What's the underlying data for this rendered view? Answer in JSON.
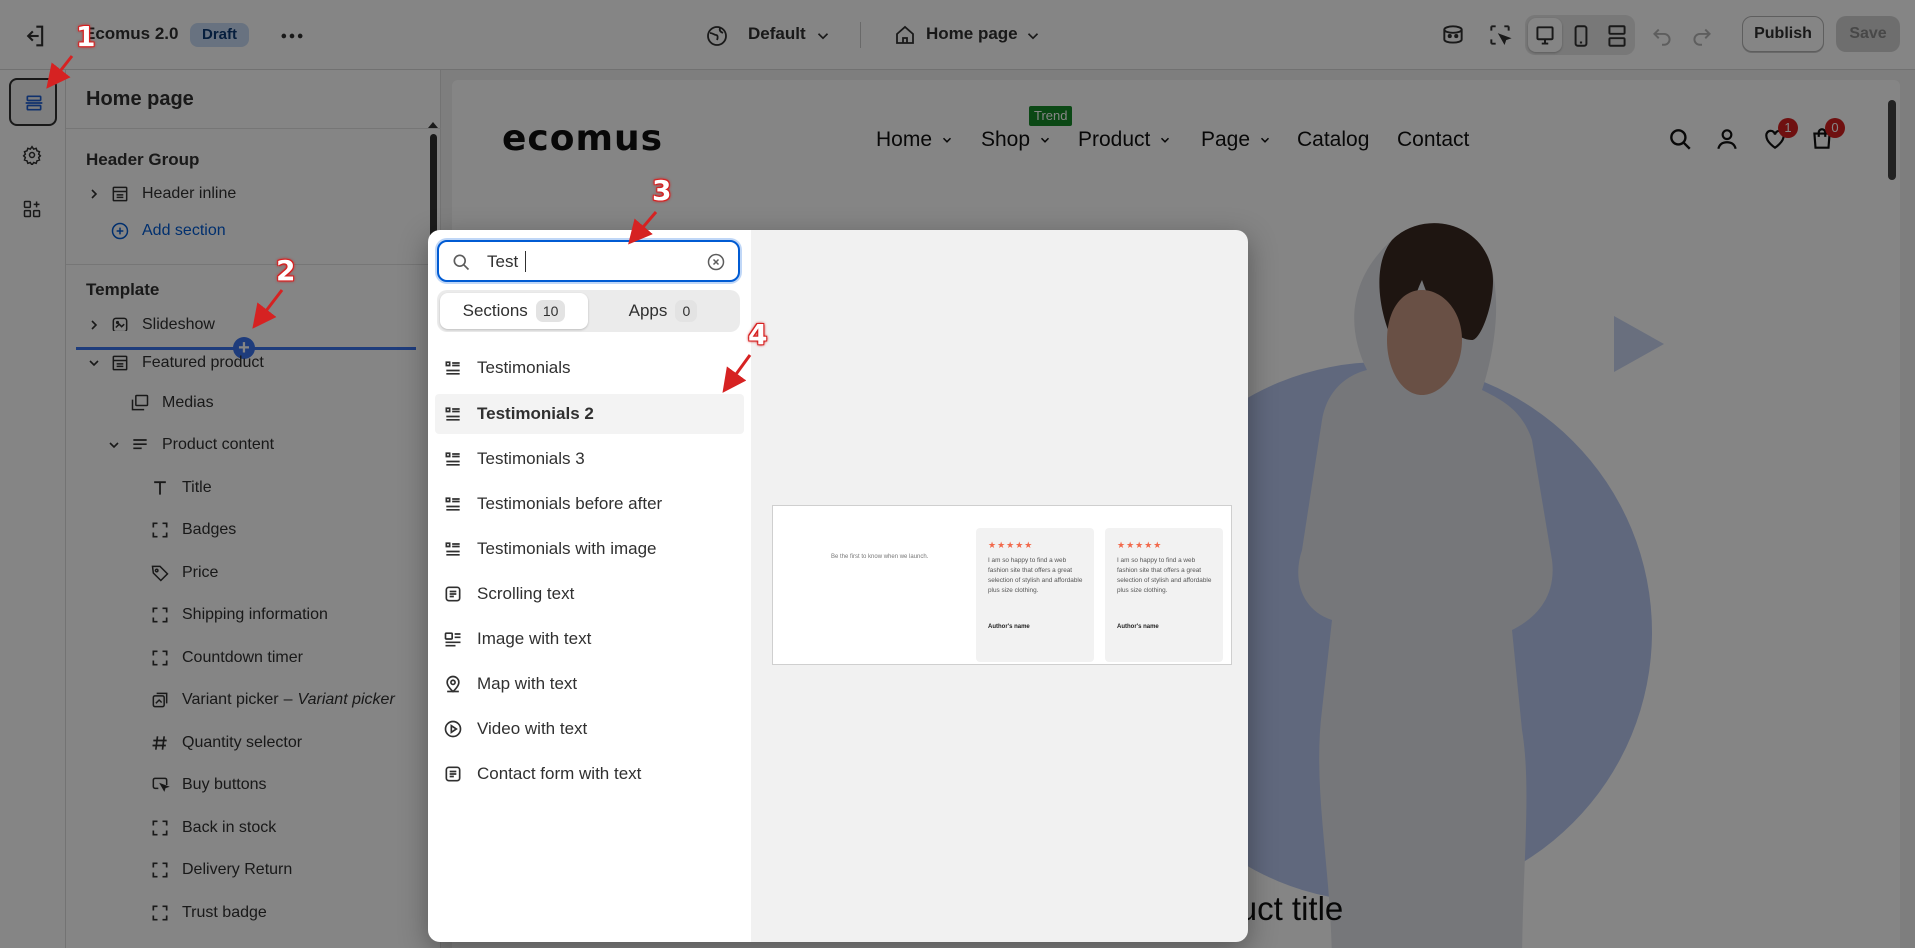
{
  "topbar": {
    "theme_name": "Ecomus 2.0",
    "status_badge": "Draft",
    "context_label": "Default",
    "page_label": "Home page",
    "publish_label": "Publish",
    "save_label": "Save"
  },
  "sidebar": {
    "title": "Home page",
    "header_group": {
      "heading": "Header Group",
      "items": [
        {
          "label": "Header inline",
          "icon": "section-icon"
        }
      ],
      "add_section_label": "Add section"
    },
    "template": {
      "heading": "Template",
      "items": [
        {
          "label": "Slideshow",
          "icon": "slideshow-icon",
          "level": 0
        },
        {
          "label": "Featured product",
          "icon": "section-icon",
          "level": 0
        },
        {
          "label": "Medias",
          "icon": "media-icon",
          "level": 1
        },
        {
          "label": "Product content",
          "icon": "text-block-icon",
          "level": 1
        },
        {
          "label": "Title",
          "icon": "type-icon",
          "level": 2
        },
        {
          "label": "Badges",
          "icon": "block-icon",
          "level": 2
        },
        {
          "label": "Price",
          "icon": "price-tag-icon",
          "level": 2
        },
        {
          "label": "Shipping information",
          "icon": "block-icon",
          "level": 2
        },
        {
          "label": "Countdown timer",
          "icon": "block-icon",
          "level": 2
        },
        {
          "label": "Variant picker",
          "suffix": "Variant picker",
          "icon": "variant-icon",
          "level": 2
        },
        {
          "label": "Quantity selector",
          "icon": "hash-icon",
          "level": 2
        },
        {
          "label": "Buy buttons",
          "icon": "cursor-icon",
          "level": 2
        },
        {
          "label": "Back in stock",
          "icon": "block-icon",
          "level": 2
        },
        {
          "label": "Delivery Return",
          "icon": "block-icon",
          "level": 2
        },
        {
          "label": "Trust badge",
          "icon": "block-icon",
          "level": 2
        }
      ]
    }
  },
  "picker": {
    "search_value": "Test",
    "tabs": [
      {
        "label": "Sections",
        "count": "10",
        "active": true
      },
      {
        "label": "Apps",
        "count": "0",
        "active": false
      }
    ],
    "results": [
      {
        "label": "Testimonials",
        "icon": "testimonials-icon"
      },
      {
        "label": "Testimonials 2",
        "icon": "testimonials-icon",
        "highlighted": true
      },
      {
        "label": "Testimonials 3",
        "icon": "testimonials-icon"
      },
      {
        "label": "Testimonials before after",
        "icon": "testimonials-icon"
      },
      {
        "label": "Testimonials with image",
        "icon": "testimonials-icon"
      },
      {
        "label": "Scrolling text",
        "icon": "text-icon"
      },
      {
        "label": "Image with text",
        "icon": "image-text-icon"
      },
      {
        "label": "Map with text",
        "icon": "map-pin-icon"
      },
      {
        "label": "Video with text",
        "icon": "play-icon"
      },
      {
        "label": "Contact form with text",
        "icon": "text-icon"
      }
    ],
    "preview": {
      "lead_text": "Be the first to know when we launch.",
      "cards": [
        {
          "stars": "★★★★★",
          "quote": "I am so happy to find a web fashion site that offers a great selection of stylish and affordable plus size clothing.",
          "author": "Author's name"
        },
        {
          "stars": "★★★★★",
          "quote": "I am so happy to find a web fashion site that offers a great selection of stylish and affordable plus size clothing.",
          "author": "Author's name"
        }
      ]
    }
  },
  "store_preview": {
    "logo": "ecomus",
    "nav": [
      {
        "label": "Home",
        "dropdown": true
      },
      {
        "label": "Shop",
        "dropdown": true,
        "badge": "Trend"
      },
      {
        "label": "Product",
        "dropdown": true
      },
      {
        "label": "Page",
        "dropdown": true
      },
      {
        "label": "Catalog",
        "dropdown": false
      },
      {
        "label": "Contact",
        "dropdown": false
      }
    ],
    "wishlist_count": "1",
    "cart_count": "0",
    "product_title_visible": "mple product title"
  },
  "annotations": [
    "1",
    "2",
    "3",
    "4"
  ],
  "colors": {
    "accent": "#005bd3",
    "insert_line": "#3b73ee",
    "annotation": "#d62222",
    "trend_badge": "#168a2a",
    "hero_circle": "#b8c8ef"
  }
}
